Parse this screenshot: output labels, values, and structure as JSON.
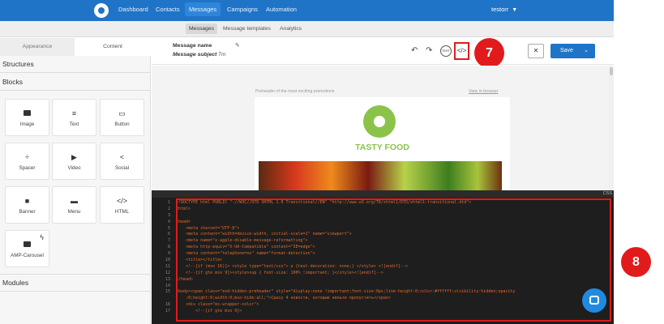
{
  "topnav": {
    "items": [
      "Dashboard",
      "Contacts",
      "Messages",
      "Campaigns",
      "Automation"
    ],
    "active": "Messages",
    "user": "testorr"
  },
  "subnav": {
    "items": [
      "Messages",
      "Message templates",
      "Analytics"
    ],
    "active": "Messages"
  },
  "leftpanel": {
    "tabs": [
      "Appearance",
      "Content"
    ],
    "active_tab": "Content",
    "sections": {
      "structures": "Structures",
      "blocks": "Blocks",
      "modules": "Modules"
    },
    "blocks": [
      {
        "label": "Image",
        "icon": "image-icon"
      },
      {
        "label": "Text",
        "icon": "text-icon"
      },
      {
        "label": "Button",
        "icon": "button-icon"
      },
      {
        "label": "Spacer",
        "icon": "spacer-icon"
      },
      {
        "label": "Video",
        "icon": "video-icon"
      },
      {
        "label": "Social",
        "icon": "share-icon"
      },
      {
        "label": "Banner",
        "icon": "banner-icon"
      },
      {
        "label": "Menu",
        "icon": "menu-icon"
      },
      {
        "label": "HTML",
        "icon": "code-icon"
      },
      {
        "label": "AMP-Carousel",
        "icon": "carousel-icon"
      }
    ]
  },
  "editor": {
    "message_name_label": "Message name",
    "message_subject_label": "Message subject",
    "test_label": "TEST",
    "save_label": "Save",
    "preheader": "Preheader of the most exciting promotions",
    "view_in_browser": "View in browser",
    "brand_name": "TASTY FOOD",
    "code_tab": "CSS"
  },
  "annotations": {
    "step7": "7",
    "step8": "8"
  },
  "code": {
    "line_numbers": [
      "1",
      "2",
      "3",
      "4",
      "5",
      "6",
      "7",
      "8",
      "9",
      "10",
      "11",
      "12",
      "13",
      "14",
      "15",
      "",
      "16",
      "17"
    ],
    "lines": [
      "<!DOCTYPE html PUBLIC \"-//W3C//DTD XHTML 1.0 Transitional//EN\" \"http://www.w3.org/TR/xhtml1/DTD/xhtml1-transitional.dtd\">",
      "<html>",
      "",
      "<head>",
      "    <meta charset=\"UTF-8\">",
      "    <meta content=\"width=device-width, initial-scale=1\" name=\"viewport\">",
      "    <meta name=\"x-apple-disable-message-reformatting\">",
      "    <meta http-equiv=\"X-UA-Compatible\" content=\"IE=edge\">",
      "    <meta content=\"telephone=no\" name=\"format-detection\">",
      "    <title></title>",
      "    <!--[if (mso 16)]> <style type=\"text/css\"> a {text-decoration: none;} </style> <![endif]-->",
      "    <!--[if gte mso 9]><style>sup { font-size: 100% !important; }</style><![endif]-->",
      "</head>",
      "",
      "<body><span class=\"esd-hidden-preheader\" style=\"display:none !important;font-size:0px;line-height:0;color:#ffffff;visibility:hidden;opacity",
      "    :0;height:0;width:0;mso-hide:all;\">Сразу 4 новости, которые нельзя пропустить</span>",
      "    <div class=\"es-wrapper-color\">",
      "        <!--[if gte mso 9]>"
    ]
  },
  "colors": {
    "primary": "#1f74c7",
    "annotation_red": "#e11b1b",
    "brand_green": "#8bc34a"
  }
}
